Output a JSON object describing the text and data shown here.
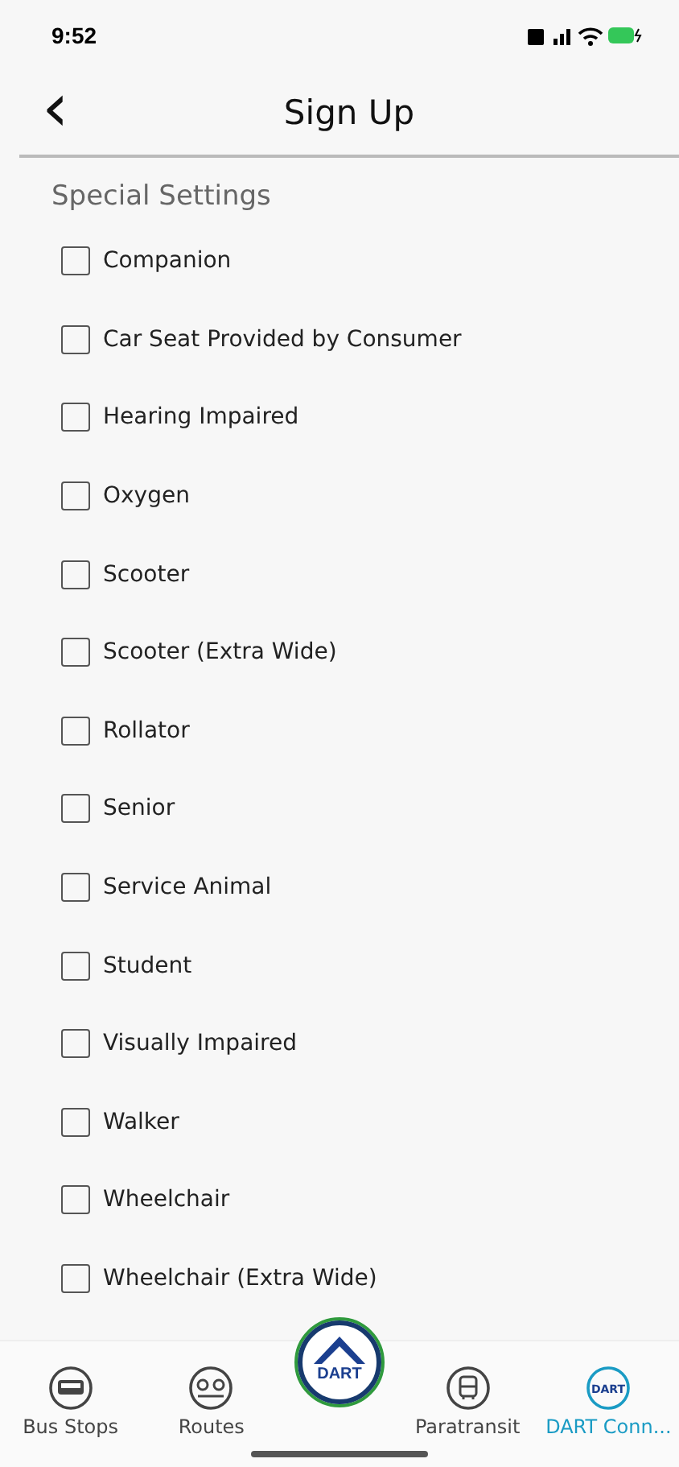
{
  "status_bar": {
    "time": "9:52"
  },
  "header": {
    "title": "Sign Up",
    "back": "‹"
  },
  "section": {
    "title": "Special Settings"
  },
  "options": [
    {
      "label": "Companion",
      "checked": false
    },
    {
      "label": "Car Seat Provided by Consumer",
      "checked": false
    },
    {
      "label": "Hearing Impaired",
      "checked": false
    },
    {
      "label": "Oxygen",
      "checked": false
    },
    {
      "label": "Scooter",
      "checked": false
    },
    {
      "label": "Scooter (Extra Wide)",
      "checked": false
    },
    {
      "label": "Rollator",
      "checked": false
    },
    {
      "label": "Senior",
      "checked": false
    },
    {
      "label": "Service Animal",
      "checked": false
    },
    {
      "label": "Student",
      "checked": false
    },
    {
      "label": "Visually Impaired",
      "checked": false
    },
    {
      "label": "Walker",
      "checked": false
    },
    {
      "label": "Wheelchair",
      "checked": false
    },
    {
      "label": "Wheelchair (Extra Wide)",
      "checked": false
    }
  ],
  "tab_bar": {
    "items": [
      {
        "kind": "bus",
        "label": "Bus Stops",
        "selected": false
      },
      {
        "kind": "routes",
        "label": "Routes",
        "selected": false
      },
      {
        "kind": "logo",
        "logo_text": "DART"
      },
      {
        "kind": "paratransit",
        "label": "Paratransit",
        "selected": false
      },
      {
        "kind": "dart",
        "label": "DART Conn...",
        "icon_text": "DART",
        "selected": true
      }
    ]
  }
}
